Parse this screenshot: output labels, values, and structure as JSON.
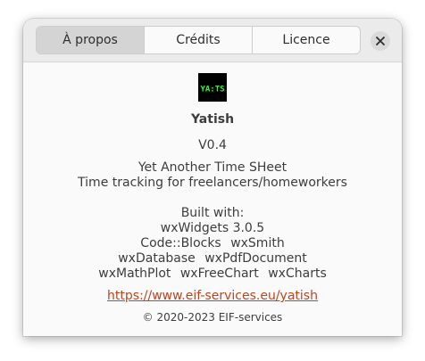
{
  "tabs": [
    {
      "label": "À propos",
      "active": true
    },
    {
      "label": "Crédits",
      "active": false
    },
    {
      "label": "Licence",
      "active": false
    }
  ],
  "close_icon": "close-icon",
  "about": {
    "logo_text": "YA:TS",
    "logo_color": "#2bff2b",
    "app_name": "Yatish",
    "version": "V0.4",
    "description_line1": "Yet Another Time SHeet",
    "description_line2": "Time tracking for freelancers/homeworkers",
    "built_with_title": "Built with:",
    "built_with_rows": [
      [
        "wxWidgets 3.0.5"
      ],
      [
        "Code::Blocks",
        "wxSmith"
      ],
      [
        "wxDatabase",
        "wxPdfDocument"
      ],
      [
        "wxMathPlot",
        "wxFreeChart",
        "wxCharts"
      ]
    ],
    "website": "https://www.eif-services.eu/yatish",
    "copyright": "© 2020-2023 EIF-services"
  },
  "colors": {
    "link": "#c0441e",
    "headerbar": "#ebebeb",
    "active_tab": "#d4d4d4"
  }
}
